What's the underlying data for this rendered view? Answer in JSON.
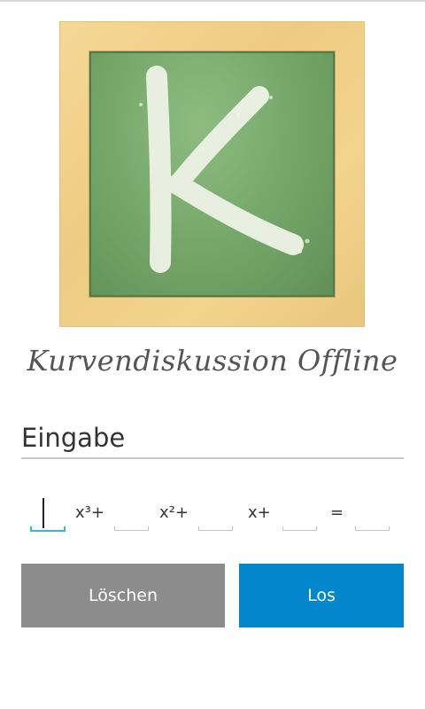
{
  "app": {
    "title": "Kurvendiskussion Offline",
    "logo_letter": "K"
  },
  "input_section": {
    "header": "Eingabe",
    "terms": [
      {
        "coefficient": "",
        "label": "x³+"
      },
      {
        "coefficient": "",
        "label": "x²+"
      },
      {
        "coefficient": "",
        "label": "x+"
      },
      {
        "coefficient": "",
        "label": "="
      },
      {
        "coefficient": ""
      }
    ]
  },
  "buttons": {
    "clear_label": "Löschen",
    "go_label": "Los"
  },
  "colors": {
    "accent_focus": "#33b5e5",
    "go_button": "#0287cd",
    "clear_button": "#8c8c8c",
    "chalkboard": "#78a96c",
    "frame_wood": "#f2d48f"
  }
}
